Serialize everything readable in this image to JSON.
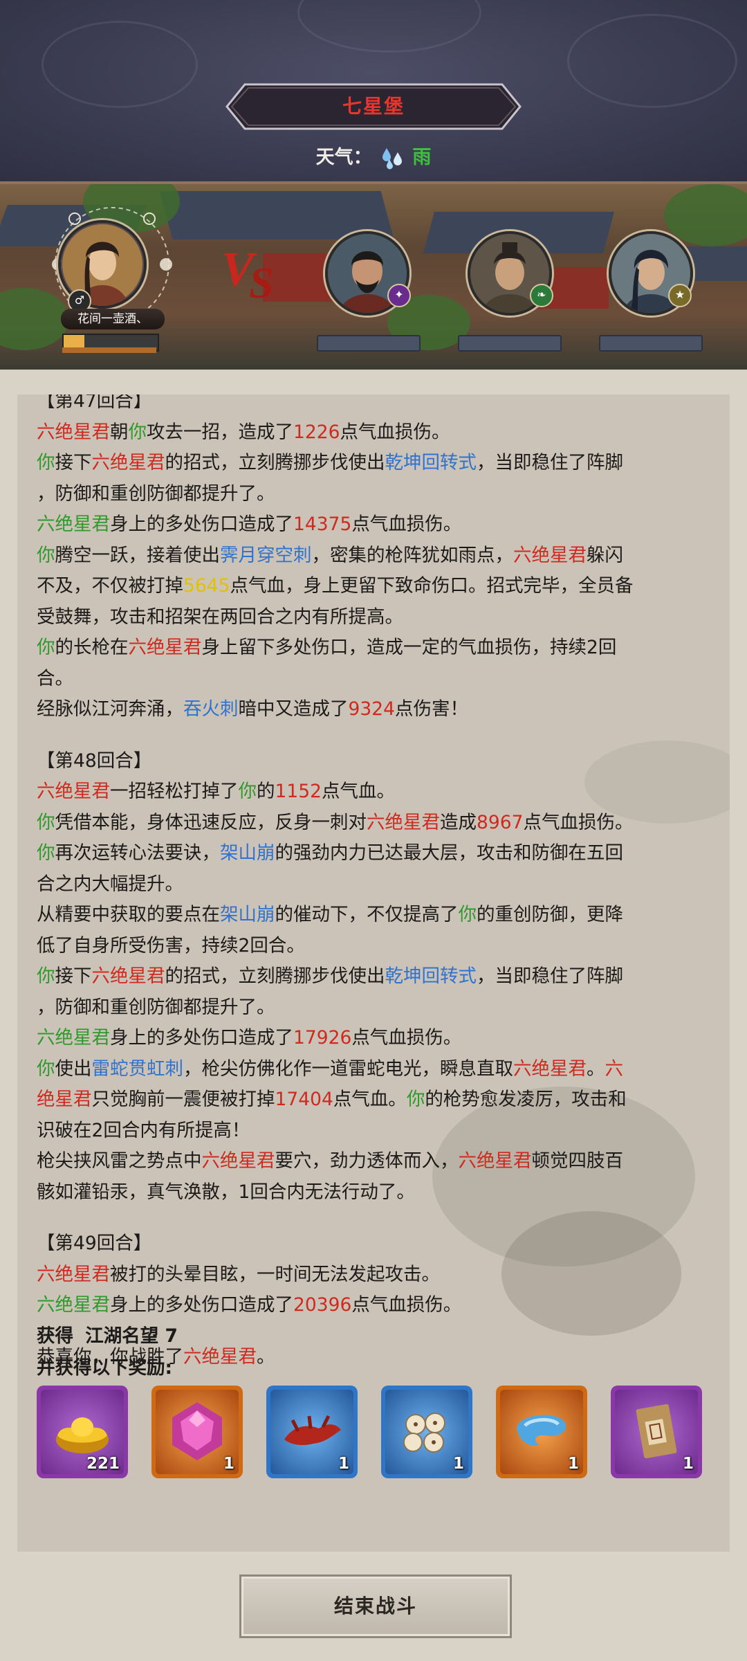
{
  "header": {
    "location_title": "七星堡",
    "weather_label": "天气：",
    "weather_value": "雨",
    "weather_icon": "rain-drops-icon"
  },
  "battle": {
    "player_name": "花间一壶酒、",
    "player_badge_icon": "male-icon",
    "vs_icon": "vs-icon",
    "enemy_badges": [
      "sword-icon",
      "leaf-icon",
      "star-icon"
    ]
  },
  "log": {
    "lines": [
      [
        {
          "t": "【第47回合】"
        }
      ],
      [
        {
          "t": "六绝星君",
          "c": "r"
        },
        {
          "t": "朝"
        },
        {
          "t": "你",
          "c": "g"
        },
        {
          "t": "攻去一招，造成了"
        },
        {
          "t": "1226",
          "c": "r"
        },
        {
          "t": "点气血损伤。"
        }
      ],
      [
        {
          "t": "你",
          "c": "g"
        },
        {
          "t": "接下"
        },
        {
          "t": "六绝星君",
          "c": "r"
        },
        {
          "t": "的招式，立刻腾挪步伐使出"
        },
        {
          "t": "乾坤回转式",
          "c": "b"
        },
        {
          "t": "，当即稳住了阵脚"
        }
      ],
      [
        {
          "t": "，防御和重创防御都提升了。"
        }
      ],
      [
        {
          "t": "六绝星君",
          "c": "g"
        },
        {
          "t": "身上的多处伤口造成了"
        },
        {
          "t": "14375",
          "c": "r"
        },
        {
          "t": "点气血损伤。"
        }
      ],
      [
        {
          "t": "你",
          "c": "g"
        },
        {
          "t": "腾空一跃，接着使出"
        },
        {
          "t": "霁月穿空刺",
          "c": "b"
        },
        {
          "t": "，密集的枪阵犹如雨点，"
        },
        {
          "t": "六绝星君",
          "c": "r"
        },
        {
          "t": "躲闪"
        }
      ],
      [
        {
          "t": "不及，不仅被打掉"
        },
        {
          "t": "5645",
          "c": "y"
        },
        {
          "t": "点气血，身上更留下致命伤口。招式完毕，全员备"
        }
      ],
      [
        {
          "t": "受鼓舞，攻击和招架在两回合之内有所提高。"
        }
      ],
      [
        {
          "t": "你",
          "c": "g"
        },
        {
          "t": "的长枪在"
        },
        {
          "t": "六绝星君",
          "c": "r"
        },
        {
          "t": "身上留下多处伤口，造成一定的气血损伤，持续2回"
        }
      ],
      [
        {
          "t": "合。"
        }
      ],
      [
        {
          "t": "经脉似江河奔涌，"
        },
        {
          "t": "吞火刺",
          "c": "b"
        },
        {
          "t": "暗中又造成了"
        },
        {
          "t": "9324",
          "c": "r"
        },
        {
          "t": "点伤害！"
        }
      ],
      [
        {
          "t": ""
        }
      ],
      [
        {
          "t": "【第48回合】"
        }
      ],
      [
        {
          "t": "六绝星君",
          "c": "r"
        },
        {
          "t": "一招轻松打掉了"
        },
        {
          "t": "你",
          "c": "g"
        },
        {
          "t": "的"
        },
        {
          "t": "1152",
          "c": "r"
        },
        {
          "t": "点气血。"
        }
      ],
      [
        {
          "t": "你",
          "c": "g"
        },
        {
          "t": "凭借本能，身体迅速反应，反身一刺对"
        },
        {
          "t": "六绝星君",
          "c": "r"
        },
        {
          "t": "造成"
        },
        {
          "t": "8967",
          "c": "r"
        },
        {
          "t": "点气血损伤。"
        }
      ],
      [
        {
          "t": "你",
          "c": "g"
        },
        {
          "t": "再次运转心法要诀，"
        },
        {
          "t": "架山崩",
          "c": "b"
        },
        {
          "t": "的强劲内力已达最大层，攻击和防御在五回"
        }
      ],
      [
        {
          "t": "合之内大幅提升。"
        }
      ],
      [
        {
          "t": "从精要中获取的要点在"
        },
        {
          "t": "架山崩",
          "c": "b"
        },
        {
          "t": "的催动下，不仅提高了"
        },
        {
          "t": "你",
          "c": "g"
        },
        {
          "t": "的重创防御，更降"
        }
      ],
      [
        {
          "t": "低了自身所受伤害，持续2回合。"
        }
      ],
      [
        {
          "t": "你",
          "c": "g"
        },
        {
          "t": "接下"
        },
        {
          "t": "六绝星君",
          "c": "r"
        },
        {
          "t": "的招式，立刻腾挪步伐使出"
        },
        {
          "t": "乾坤回转式",
          "c": "b"
        },
        {
          "t": "，当即稳住了阵脚"
        }
      ],
      [
        {
          "t": "，防御和重创防御都提升了。"
        }
      ],
      [
        {
          "t": "六绝星君",
          "c": "g"
        },
        {
          "t": "身上的多处伤口造成了"
        },
        {
          "t": "17926",
          "c": "r"
        },
        {
          "t": "点气血损伤。"
        }
      ],
      [
        {
          "t": "你",
          "c": "g"
        },
        {
          "t": "使出"
        },
        {
          "t": "雷蛇贯虹刺",
          "c": "b"
        },
        {
          "t": "，枪尖仿佛化作一道雷蛇电光，瞬息直取"
        },
        {
          "t": "六绝星君",
          "c": "r"
        },
        {
          "t": "。"
        },
        {
          "t": "六",
          "c": "r"
        }
      ],
      [
        {
          "t": "绝星君",
          "c": "r"
        },
        {
          "t": "只觉胸前一震便被打掉"
        },
        {
          "t": "17404",
          "c": "r"
        },
        {
          "t": "点气血。"
        },
        {
          "t": "你",
          "c": "g"
        },
        {
          "t": "的枪势愈发凌厉，攻击和"
        }
      ],
      [
        {
          "t": "识破在2回合内有所提高！"
        }
      ],
      [
        {
          "t": "枪尖挟风雷之势点中"
        },
        {
          "t": "六绝星君",
          "c": "r"
        },
        {
          "t": "要穴，劲力透体而入，"
        },
        {
          "t": "六绝星君",
          "c": "r"
        },
        {
          "t": "顿觉四肢百"
        }
      ],
      [
        {
          "t": "骸如灌铅汞，真气涣散，1回合内无法行动了。"
        }
      ],
      [
        {
          "t": ""
        }
      ],
      [
        {
          "t": "【第49回合】"
        }
      ],
      [
        {
          "t": "六绝星君",
          "c": "r"
        },
        {
          "t": "被打的头晕目眩，一时间无法发起攻击。"
        }
      ],
      [
        {
          "t": "六绝星君",
          "c": "g"
        },
        {
          "t": "身上的多处伤口造成了"
        },
        {
          "t": "20396",
          "c": "r"
        },
        {
          "t": "点气血损伤。"
        }
      ],
      [
        {
          "t": ""
        }
      ],
      [
        {
          "t": "恭喜你，你战胜了"
        },
        {
          "t": "六绝星君",
          "c": "r"
        },
        {
          "t": "。"
        }
      ]
    ]
  },
  "rewards": {
    "obtain_label": "获得",
    "reputation_label": "江湖名望 7",
    "and_label": "并获得以下奖励:",
    "items": [
      {
        "icon": "gold-ingot-icon",
        "qty": "221",
        "rarity": "purple"
      },
      {
        "icon": "pink-gem-icon",
        "qty": "1",
        "rarity": "orange"
      },
      {
        "icon": "red-herb-icon",
        "qty": "1",
        "rarity": "blue"
      },
      {
        "icon": "lotus-seeds-icon",
        "qty": "1",
        "rarity": "blue"
      },
      {
        "icon": "blue-scarf-icon",
        "qty": "1",
        "rarity": "orange"
      },
      {
        "icon": "secret-letter-icon",
        "qty": "1",
        "rarity": "purple"
      }
    ]
  },
  "actions": {
    "end_battle_label": "结束战斗"
  }
}
